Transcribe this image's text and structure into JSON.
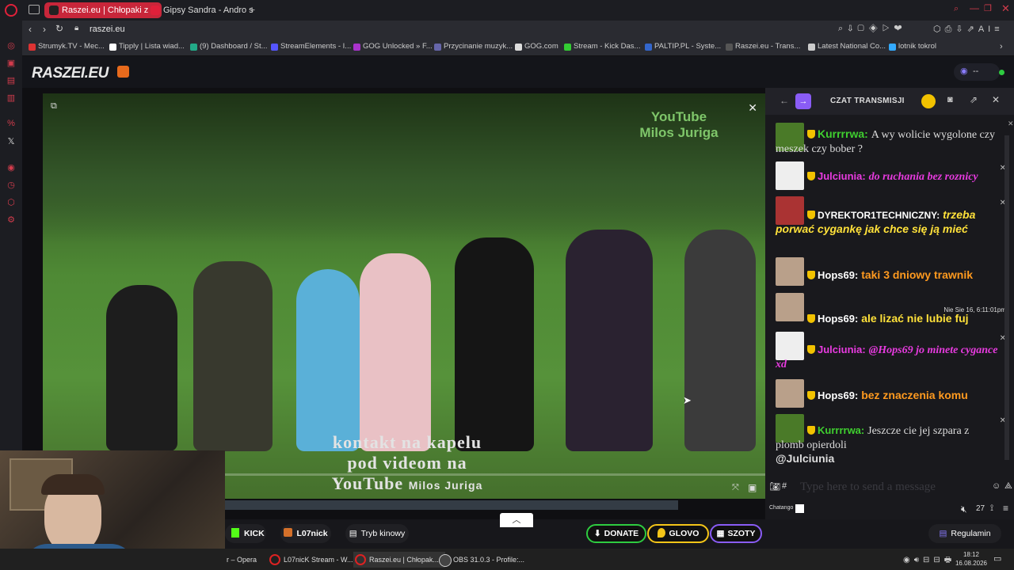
{
  "browser": {
    "tabs": [
      {
        "label": "Raszei.eu | Chłopaki z",
        "active": true
      },
      {
        "label": "Gipsy Sandra - Andro s",
        "active": false
      }
    ],
    "url": "raszei.eu",
    "bookmarks": [
      "Strumyk.TV - Mec...",
      "Tipply | Lista wiad...",
      "(9) Dashboard / St...",
      "StreamElements - I...",
      "GOG Unlocked » F...",
      "Przycinanie muzyk...",
      "GOG.com",
      "Stream - Kick Das...",
      "PALTIP.PL - Syste...",
      "Raszei.eu - Trans...",
      "Latest National Co...",
      "lotnik tokrol"
    ]
  },
  "site": {
    "logo": "RASZEI.EU",
    "viewer_count": "--"
  },
  "video": {
    "watermark_line1": "YouTube",
    "watermark_line2": "Milos Juriga",
    "caption_line1": "kontakt na kapelu",
    "caption_line2": "pod videom na",
    "caption_line3": "YouTube",
    "caption_line3b": "Milos Juriga",
    "progress": 0.07
  },
  "chat": {
    "title": "CZAT TRANSMISJI",
    "messages": [
      {
        "user": "Kurrrrwa:",
        "text": "A wy wolicie wygolone czy meszek czy bober ?",
        "user_color": "#3fcf2f",
        "text_color": "#ffffff"
      },
      {
        "user": "Julciunia:",
        "text": "do ruchania bez roznicy",
        "user_color": "#e83be0",
        "text_color": "#e83be0"
      },
      {
        "user": "DYREKTOR1TECHNICZNY:",
        "text": "trzeba porwać cygankę jak chce się ją mieć",
        "user_color": "#ffffff",
        "text_color": "#ffe13a"
      },
      {
        "user": "Hops69:",
        "text": "taki 3 dniowy trawnik",
        "user_color": "#ffffff",
        "text_color": "#ff9a1f"
      },
      {
        "user": "Hops69:",
        "text": "ale lizać nie lubie fuj",
        "user_color": "#ffffff",
        "text_color": "#ffe13a",
        "timestamp": "Nie Sie 16, 6:11:01pm"
      },
      {
        "user": "Julciunia:",
        "text": "@Hops69 jo minete cygance xd",
        "user_color": "#e83be0",
        "text_color": "#e83be0"
      },
      {
        "user": "Hops69:",
        "text": "bez znaczenia komu",
        "user_color": "#ffffff",
        "text_color": "#ff9a1f"
      },
      {
        "user": "Kurrrrwa:",
        "text": "Jeszcze cie jej szpara z plomb opierdoli",
        "mention": "@Julciunia",
        "user_color": "#3fcf2f",
        "text_color": "#ffffff"
      }
    ],
    "input_placeholder": "Type here to send a message",
    "chatango_label": "Chatango",
    "online_count": "27"
  },
  "bottombar": {
    "kick": "KICK",
    "channel": "L07nick",
    "cinema": "Tryb kinowy",
    "donate": "DONATE",
    "glovo": "GLOVO",
    "szoty": "SZOTY",
    "rules": "Regulamin"
  },
  "taskbar": {
    "items": [
      "r – Opera",
      "L07nicK Stream - W...",
      "Raszei.eu | Chłopak...",
      "OBS 31.0.3 - Profile:..."
    ],
    "time": "18:12",
    "date": "16.08.2026"
  },
  "colors": {
    "accent": "#8a5cf6",
    "kick": "#53fc18",
    "donate": "#2ecc40",
    "glovo": "#f5c518"
  }
}
